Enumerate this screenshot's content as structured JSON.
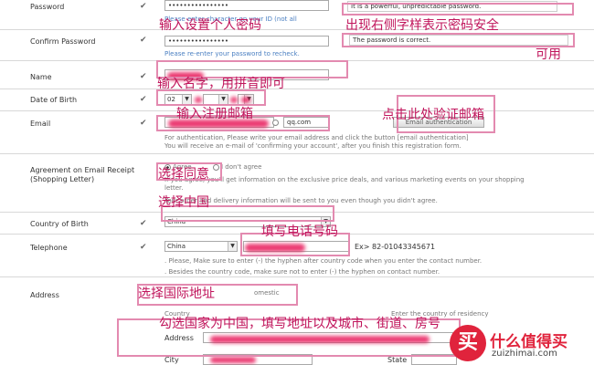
{
  "form": {
    "password": {
      "label": "Password",
      "value": "••••••••••••••••",
      "hint_prefix": "Please enter ",
      "hint_suffix": "character on your ID (not all"
    },
    "confirm_password": {
      "label": "Confirm Password",
      "value": "••••••••••••••••",
      "hint": "Please re-enter your password to recheck."
    },
    "name": {
      "label": "Name"
    },
    "dob": {
      "label": "Date of Birth",
      "year": "02",
      "month": "",
      "day": ""
    },
    "email": {
      "label": "Email",
      "domain": "qq.com",
      "auth_button": "Email authentication",
      "help_line1": "For authentication, Please write your email address and click the button [email authentication]",
      "help_line2": "You will receive an e-mail of 'confirming your account', after you finish this registration form."
    },
    "agreement": {
      "label_line1": "Agreement on Email Receipt",
      "label_line2": "(Shopping Letter)",
      "opt_agree": "Agree",
      "opt_disagree": "I don't agree",
      "desc_line1": "If you agree, you'll get information on the exclusive price deals, and various marketing events on your shopping",
      "desc_line2": "letter.",
      "desc_line3": "Your order and delivery information will be sent to you even though you didn't agree."
    },
    "country_of_birth": {
      "label": "Country of Birth",
      "value": "China"
    },
    "telephone": {
      "label": "Telephone",
      "country": "China",
      "example": "Ex> 82-01043345671",
      "note1": ". Please, Make sure to enter (-) the hyphen after country code when you enter the contact number.",
      "note2": ". Besides the country code, make sure not to enter (-) the hyphen on contact number."
    },
    "address": {
      "label": "Address",
      "domestic": "omestic",
      "country_prefix": "Country",
      "country_suffix": "Enter the country of residency",
      "address_label": "Address",
      "city_label": "City",
      "state_label": "State"
    }
  },
  "status": {
    "password_strength": "It is a powerful, unpredictable password.",
    "password_match": "The password is correct."
  },
  "annotations": {
    "set_password": "输入设置个人密码",
    "right_side_shows_line1": "出现右侧字样表示密码安全",
    "right_side_shows_line2": "可用",
    "enter_name": "输入名字，用拼音即可",
    "enter_email": "输入注册邮箱",
    "click_verify": "点击此处验证邮箱",
    "select_agree": "选择同意",
    "select_china": "选择中国",
    "fill_phone": "填写电话号码",
    "select_intl": "选择国际地址",
    "fill_address": "勾选国家为中国，填写地址以及城市、街道、房号"
  },
  "watermark": {
    "glyph": "买",
    "name": "什么值得买",
    "url": "zuizhimai.com"
  },
  "colors": {
    "annotation": "#c0145b",
    "annotation_box": "#e38ab0",
    "redaction": "#e8195a",
    "hint_blue": "#4a7fc1",
    "brand_red": "#e0233c"
  }
}
